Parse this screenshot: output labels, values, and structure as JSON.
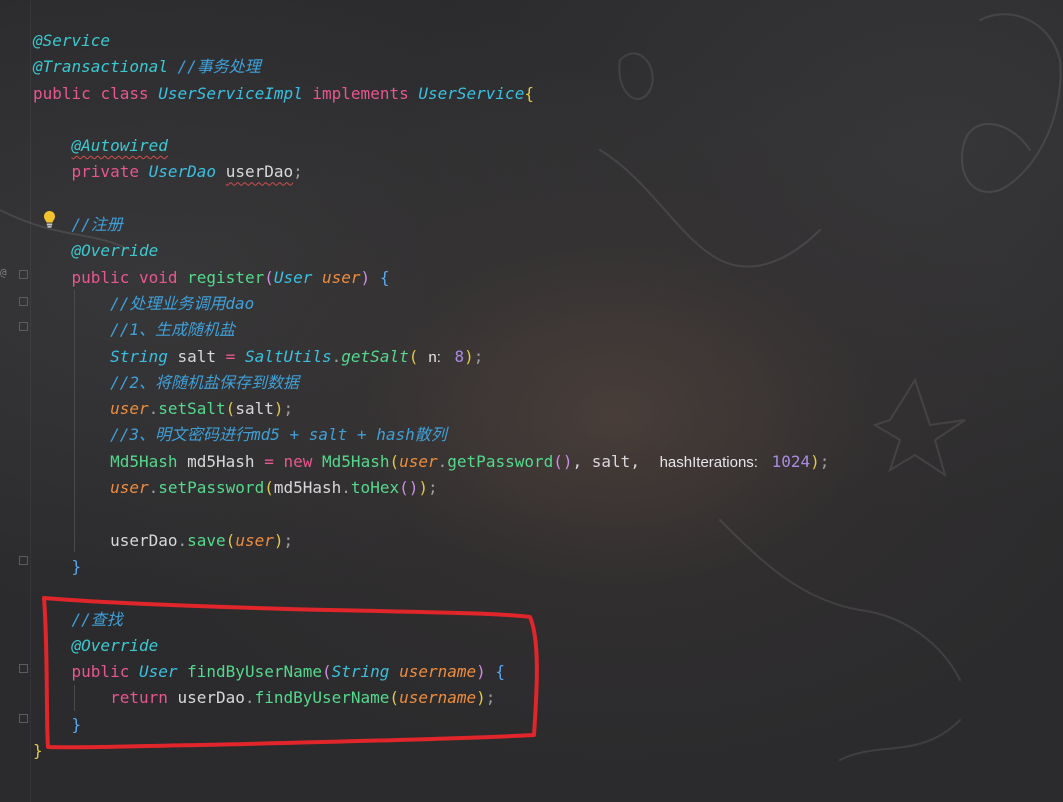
{
  "editor": {
    "lines": [
      [
        {
          "t": "@Service",
          "c": "ann"
        }
      ],
      [
        {
          "t": "@Transactional",
          "c": "ann"
        },
        {
          "t": " //事务处理",
          "c": "cm"
        }
      ],
      [
        {
          "t": "public",
          "c": "kw"
        },
        {
          "t": " ",
          "c": "txt"
        },
        {
          "t": "class",
          "c": "kw"
        },
        {
          "t": " ",
          "c": "txt"
        },
        {
          "t": "UserServiceImpl",
          "c": "ty"
        },
        {
          "t": " ",
          "c": "txt"
        },
        {
          "t": "implements",
          "c": "kw"
        },
        {
          "t": " ",
          "c": "txt"
        },
        {
          "t": "UserService",
          "c": "ty"
        },
        {
          "t": "{",
          "c": "br"
        }
      ],
      [],
      [
        {
          "t": "    ",
          "c": "txt"
        },
        {
          "t": "@Autowired",
          "c": "ann squig"
        }
      ],
      [
        {
          "t": "    ",
          "c": "txt"
        },
        {
          "t": "private",
          "c": "kw"
        },
        {
          "t": " ",
          "c": "txt"
        },
        {
          "t": "UserDao",
          "c": "ty"
        },
        {
          "t": " ",
          "c": "txt"
        },
        {
          "t": "userDao",
          "c": "txt squig"
        },
        {
          "t": ";",
          "c": "pun"
        }
      ],
      [],
      [
        {
          "t": "    ",
          "c": "txt"
        },
        {
          "t": "//注册",
          "c": "cm"
        }
      ],
      [
        {
          "t": "    ",
          "c": "txt"
        },
        {
          "t": "@Override",
          "c": "ann"
        }
      ],
      [
        {
          "t": "    ",
          "c": "txt"
        },
        {
          "t": "public",
          "c": "kw"
        },
        {
          "t": " ",
          "c": "txt"
        },
        {
          "t": "void",
          "c": "kw"
        },
        {
          "t": " ",
          "c": "txt"
        },
        {
          "t": "register",
          "c": "fn"
        },
        {
          "t": "(",
          "c": "br2"
        },
        {
          "t": "User",
          "c": "ty"
        },
        {
          "t": " ",
          "c": "txt"
        },
        {
          "t": "user",
          "c": "pr"
        },
        {
          "t": ")",
          "c": "br2"
        },
        {
          "t": " ",
          "c": "txt"
        },
        {
          "t": "{",
          "c": "br3"
        }
      ],
      [
        {
          "t": "        ",
          "c": "txt"
        },
        {
          "t": "//处理业务调用dao",
          "c": "cm"
        }
      ],
      [
        {
          "t": "        ",
          "c": "txt"
        },
        {
          "t": "//1、生成随机盐",
          "c": "cm"
        }
      ],
      [
        {
          "t": "        ",
          "c": "txt"
        },
        {
          "t": "String",
          "c": "ty"
        },
        {
          "t": " salt ",
          "c": "txt"
        },
        {
          "t": "=",
          "c": "kw"
        },
        {
          "t": " ",
          "c": "txt"
        },
        {
          "t": "SaltUtils",
          "c": "ty"
        },
        {
          "t": ".",
          "c": "pun"
        },
        {
          "t": "getSalt",
          "c": "fni"
        },
        {
          "t": "(",
          "c": "br"
        },
        {
          "t": "n:",
          "c": "hint"
        },
        {
          "t": " ",
          "c": "txt"
        },
        {
          "t": "8",
          "c": "num"
        },
        {
          "t": ")",
          "c": "br"
        },
        {
          "t": ";",
          "c": "pun"
        }
      ],
      [
        {
          "t": "        ",
          "c": "txt"
        },
        {
          "t": "//2、将随机盐保存到数据",
          "c": "cm"
        }
      ],
      [
        {
          "t": "        ",
          "c": "txt"
        },
        {
          "t": "user",
          "c": "pr"
        },
        {
          "t": ".",
          "c": "pun"
        },
        {
          "t": "setSalt",
          "c": "fn"
        },
        {
          "t": "(",
          "c": "br"
        },
        {
          "t": "salt",
          "c": "txt"
        },
        {
          "t": ")",
          "c": "br"
        },
        {
          "t": ";",
          "c": "pun"
        }
      ],
      [
        {
          "t": "        ",
          "c": "txt"
        },
        {
          "t": "//3、明文密码进行md5 + salt + hash散列",
          "c": "cm"
        }
      ],
      [
        {
          "t": "        ",
          "c": "txt"
        },
        {
          "t": "Md5Hash",
          "c": "fn"
        },
        {
          "t": " md5Hash ",
          "c": "txt"
        },
        {
          "t": "=",
          "c": "kw"
        },
        {
          "t": " ",
          "c": "txt"
        },
        {
          "t": "new",
          "c": "kw"
        },
        {
          "t": " ",
          "c": "txt"
        },
        {
          "t": "Md5Hash",
          "c": "fn"
        },
        {
          "t": "(",
          "c": "br"
        },
        {
          "t": "user",
          "c": "pr"
        },
        {
          "t": ".",
          "c": "pun"
        },
        {
          "t": "getPassword",
          "c": "fn"
        },
        {
          "t": "()",
          "c": "br2"
        },
        {
          "t": ", salt, ",
          "c": "txt"
        },
        {
          "t": "hashIterations:",
          "c": "hint"
        },
        {
          "t": " ",
          "c": "txt"
        },
        {
          "t": "1024",
          "c": "num"
        },
        {
          "t": ")",
          "c": "br"
        },
        {
          "t": ";",
          "c": "pun"
        }
      ],
      [
        {
          "t": "        ",
          "c": "txt"
        },
        {
          "t": "user",
          "c": "pr"
        },
        {
          "t": ".",
          "c": "pun"
        },
        {
          "t": "setPassword",
          "c": "fn"
        },
        {
          "t": "(",
          "c": "br"
        },
        {
          "t": "md5Hash",
          "c": "txt"
        },
        {
          "t": ".",
          "c": "pun"
        },
        {
          "t": "toHex",
          "c": "fn"
        },
        {
          "t": "()",
          "c": "br2"
        },
        {
          "t": ")",
          "c": "br"
        },
        {
          "t": ";",
          "c": "pun"
        }
      ],
      [],
      [
        {
          "t": "        ",
          "c": "txt"
        },
        {
          "t": "userDao",
          "c": "txt"
        },
        {
          "t": ".",
          "c": "pun"
        },
        {
          "t": "save",
          "c": "fn"
        },
        {
          "t": "(",
          "c": "br"
        },
        {
          "t": "user",
          "c": "pr"
        },
        {
          "t": ")",
          "c": "br"
        },
        {
          "t": ";",
          "c": "pun"
        }
      ],
      [
        {
          "t": "    ",
          "c": "txt"
        },
        {
          "t": "}",
          "c": "br3"
        }
      ],
      [],
      [
        {
          "t": "    ",
          "c": "txt"
        },
        {
          "t": "//查找",
          "c": "cm"
        }
      ],
      [
        {
          "t": "    ",
          "c": "txt"
        },
        {
          "t": "@Override",
          "c": "ann"
        }
      ],
      [
        {
          "t": "    ",
          "c": "txt"
        },
        {
          "t": "public",
          "c": "kw"
        },
        {
          "t": " ",
          "c": "txt"
        },
        {
          "t": "User",
          "c": "ty"
        },
        {
          "t": " ",
          "c": "txt"
        },
        {
          "t": "findByUserName",
          "c": "fn"
        },
        {
          "t": "(",
          "c": "br2"
        },
        {
          "t": "String",
          "c": "ty"
        },
        {
          "t": " ",
          "c": "txt"
        },
        {
          "t": "username",
          "c": "pr"
        },
        {
          "t": ")",
          "c": "br2"
        },
        {
          "t": " ",
          "c": "txt"
        },
        {
          "t": "{",
          "c": "br3"
        }
      ],
      [
        {
          "t": "        ",
          "c": "txt"
        },
        {
          "t": "return",
          "c": "kw"
        },
        {
          "t": " userDao",
          "c": "txt"
        },
        {
          "t": ".",
          "c": "pun"
        },
        {
          "t": "findByUserName",
          "c": "fn"
        },
        {
          "t": "(",
          "c": "br"
        },
        {
          "t": "username",
          "c": "pr"
        },
        {
          "t": ")",
          "c": "br"
        },
        {
          "t": ";",
          "c": "pun"
        }
      ],
      [
        {
          "t": "    ",
          "c": "txt"
        },
        {
          "t": "}",
          "c": "br3"
        }
      ],
      [
        {
          "t": "}",
          "c": "br"
        }
      ]
    ]
  },
  "gutter": {
    "override_marker": "@"
  },
  "colors": {
    "highlight_box": "#e0262b",
    "background": "#2b2b2d"
  },
  "icons": [
    "lightbulb-icon",
    "override-marker-icon",
    "fold-icon"
  ]
}
